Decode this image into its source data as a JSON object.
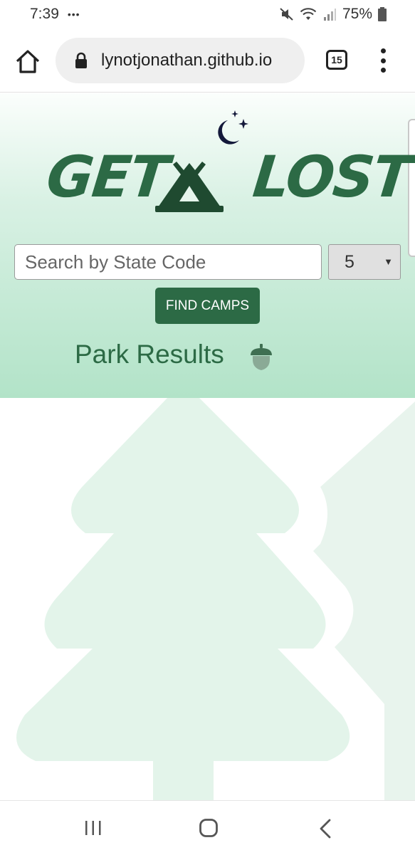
{
  "status": {
    "time": "7:39",
    "notification_dots": "•••",
    "battery": "75%"
  },
  "browser": {
    "url": "lynotjonathan.github.io",
    "tab_count": "15"
  },
  "header": {
    "logo_left": "GET",
    "logo_right": "LOST"
  },
  "search": {
    "placeholder": "Search by State Code",
    "count_value": "5",
    "button_label": "FIND CAMPS"
  },
  "results": {
    "title": "Park Results"
  },
  "colors": {
    "brand_green": "#2c6a45",
    "tree_light": "#e3f4ea"
  },
  "icons": [
    "home-icon",
    "lock-icon",
    "tabs-icon",
    "menu-icon",
    "tent-icon",
    "moon-icon",
    "acorn-icon",
    "recent-apps-icon",
    "nav-home-icon",
    "back-icon"
  ]
}
